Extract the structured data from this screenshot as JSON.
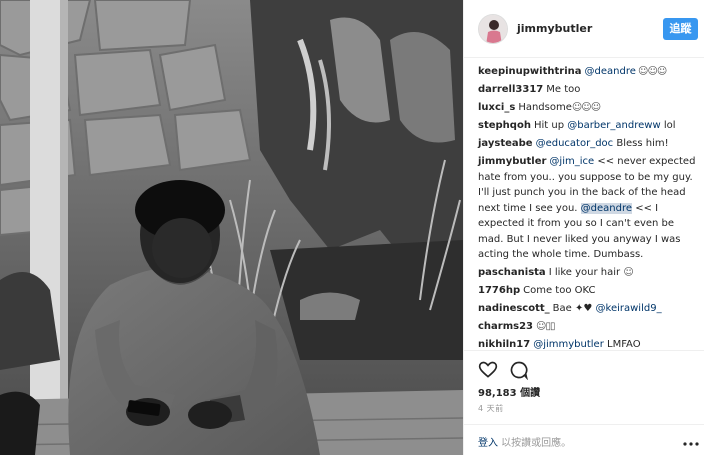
{
  "post": {
    "username": "jimmybutler",
    "follow_label": "追蹤",
    "comments": [
      {
        "user": "keepinupwithtrina",
        "parts": [
          {
            "t": "@deandre",
            "m": true
          },
          {
            "t": " ☺☺☺",
            "e": true
          }
        ]
      },
      {
        "user": "darrell3317",
        "parts": [
          {
            "t": "Me too"
          }
        ]
      },
      {
        "user": "luxci_s",
        "parts": [
          {
            "t": "Handsome"
          },
          {
            "t": "☺☺☺",
            "e": true
          }
        ]
      },
      {
        "user": "stephqoh",
        "parts": [
          {
            "t": "Hit up "
          },
          {
            "t": "@barber_andreww",
            "m": true
          },
          {
            "t": " lol"
          }
        ]
      },
      {
        "user": "jaysteabe",
        "parts": [
          {
            "t": "@educator_doc",
            "m": true
          },
          {
            "t": " Bless him!"
          }
        ]
      },
      {
        "user": "jimmybutler",
        "parts": [
          {
            "t": "@jim_ice",
            "m": true
          },
          {
            "t": " << never expected hate from you.. you suppose to be my guy. I'll just punch you in the back of the head next time I see you. "
          },
          {
            "t": "@deandre",
            "m": true,
            "h": true
          },
          {
            "t": " << I expected it from you so I can't even be mad. But I never liked you anyway I was acting the whole time. Dumbass."
          }
        ]
      },
      {
        "user": "paschanista",
        "parts": [
          {
            "t": "I like your hair "
          },
          {
            "t": "☺",
            "e": true
          }
        ]
      },
      {
        "user": "1776hp",
        "parts": [
          {
            "t": "Come too OKC"
          }
        ]
      },
      {
        "user": "nadinescott_",
        "parts": [
          {
            "t": "Bae ✦♥ "
          },
          {
            "t": "@keirawild9_",
            "m": true
          }
        ]
      },
      {
        "user": "charms23",
        "parts": [
          {
            "t": "☺▯▯",
            "e": true
          }
        ]
      },
      {
        "user": "nikhiln17",
        "parts": [
          {
            "t": "@jimmybutler",
            "m": true
          },
          {
            "t": " LMFAO"
          }
        ]
      }
    ],
    "likes": "98,183 個讚",
    "time": "4 天前",
    "login_link": "登入",
    "login_rest": " 以按讚或回應。"
  },
  "icons": {
    "like": "heart-icon",
    "comment": "comment-bubble-icon",
    "more": "more-options-icon"
  },
  "colors": {
    "follow": "#3897f0",
    "mention": "#003569",
    "muted": "#999999"
  }
}
